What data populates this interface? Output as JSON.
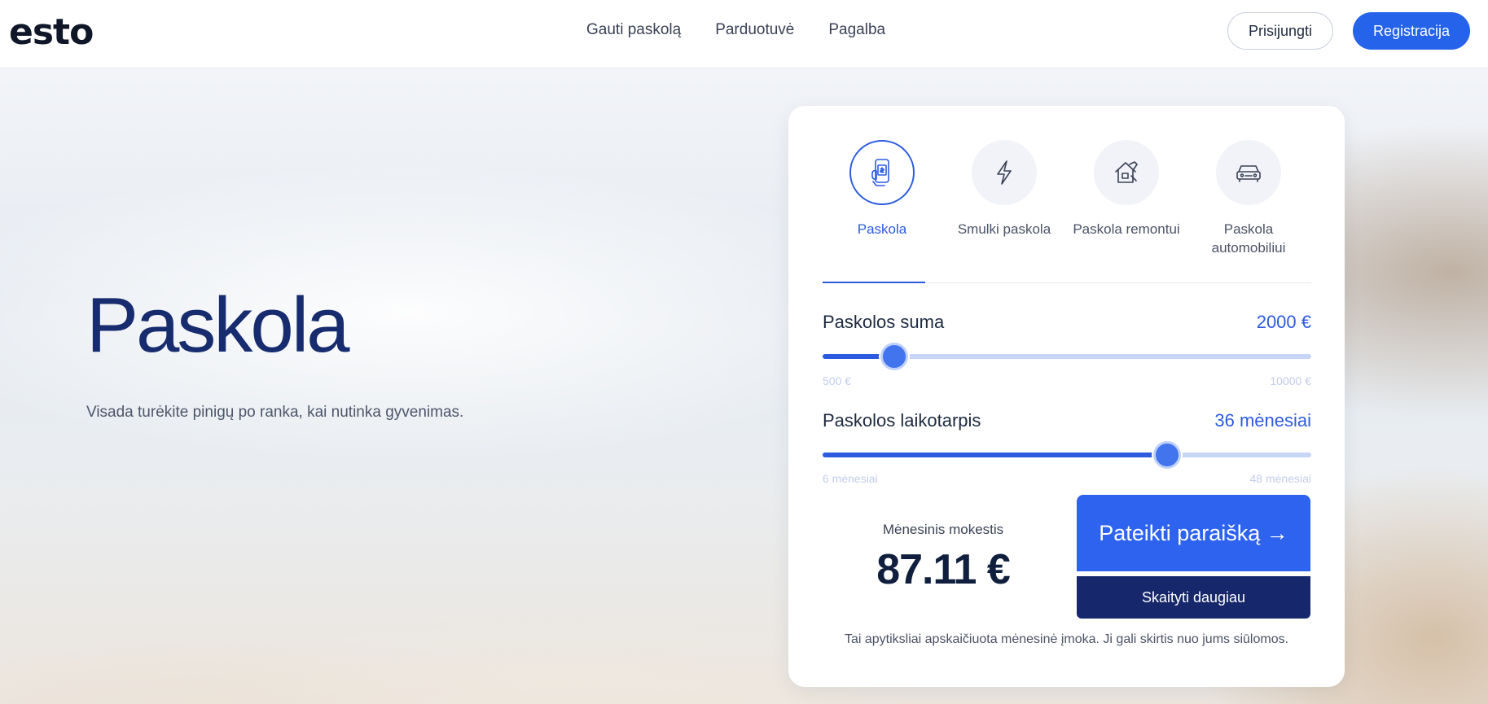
{
  "header": {
    "logo": "esto",
    "nav": [
      {
        "label": "Gauti paskolą"
      },
      {
        "label": "Parduotuvė"
      },
      {
        "label": "Pagalba"
      }
    ],
    "login_label": "Prisijungti",
    "register_label": "Registracija"
  },
  "hero": {
    "title": "Paskola",
    "subtitle": "Visada turėkite pinigų po ranka, kai nutinka gyvenimas."
  },
  "calculator": {
    "loan_types": [
      {
        "label": "Paskola",
        "icon": "phone-money-icon",
        "active": true
      },
      {
        "label": "Smulki paskola",
        "icon": "lightning-icon",
        "active": false
      },
      {
        "label": "Paskola remontui",
        "icon": "house-repair-icon",
        "active": false
      },
      {
        "label": "Paskola automobiliui",
        "icon": "car-icon",
        "active": false
      }
    ],
    "amount": {
      "label": "Paskolos suma",
      "value": "2000 €",
      "min": "500 €",
      "max": "10000 €",
      "level": 0.147
    },
    "term": {
      "label": "Paskolos laikotarpis",
      "value": "36 mėnesiai",
      "min": "6 mėnesiai",
      "max": "48 mėnesiai",
      "level": 0.705
    },
    "monthly_label": "Mėnesinis mokestis",
    "monthly_value": "87.11 €",
    "apply_label": "Pateikti paraišką →",
    "more_label": "Skaityti daugiau",
    "note": "Tai apytiksliai apskaičiuota mėnesinė įmoka. Ji gali skirtis nuo jums siūlomos."
  },
  "colors": {
    "accent": "#2c5be0",
    "brand_dark": "#16286b",
    "title": "#172c6e"
  }
}
